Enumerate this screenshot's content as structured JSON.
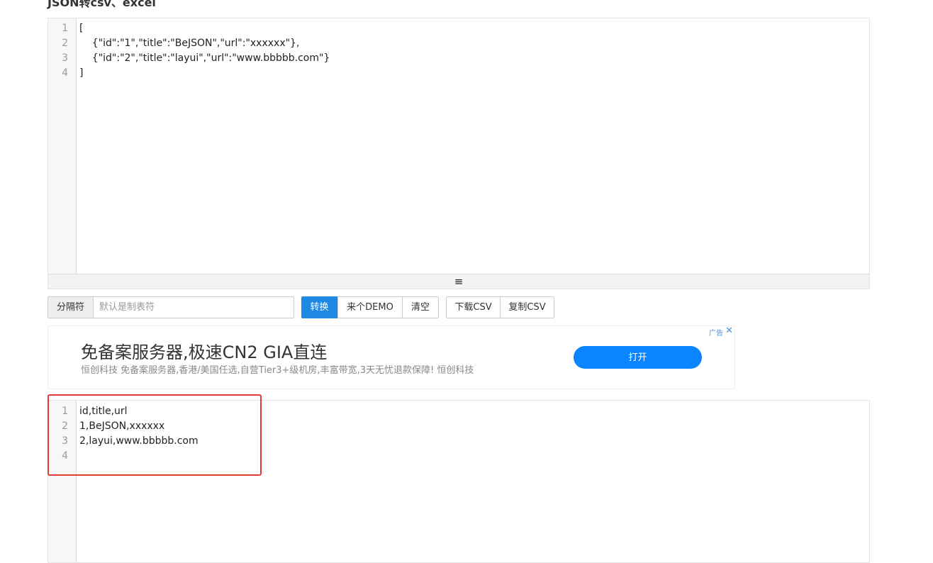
{
  "page": {
    "title": "JSON转csv、excel"
  },
  "input_editor": {
    "line_numbers": "1\n2\n3\n4",
    "content": "[\n    {\"id\":\"1\",\"title\":\"BeJSON\",\"url\":\"xxxxxx\"},\n    {\"id\":\"2\",\"title\":\"layui\",\"url\":\"www.bbbbb.com\"}\n]",
    "resize_handle": "≡"
  },
  "toolbar": {
    "separator_label": "分隔符",
    "separator_placeholder": "默认是制表符",
    "convert_label": "转换",
    "demo_label": "来个DEMO",
    "clear_label": "清空",
    "download_label": "下载CSV",
    "copy_label": "复制CSV"
  },
  "ad": {
    "headline": "免备案服务器,极速CN2 GIA直连",
    "description": "恒创科技 免备案服务器,香港/美国任选,自营Tier3+级机房,丰富带宽,3天无忧退款保障! 恒创科技",
    "open_label": "打开",
    "ad_tag": "广告",
    "close_icon": "✕"
  },
  "output_editor": {
    "line_numbers": "1\n2\n3\n4",
    "content": "id,title,url\n1,BeJSON,xxxxxx\n2,layui,www.bbbbb.com\n"
  },
  "colors": {
    "primary_button": "#1e88e5",
    "ad_button": "#0a84ff",
    "highlight": "#e53935"
  }
}
